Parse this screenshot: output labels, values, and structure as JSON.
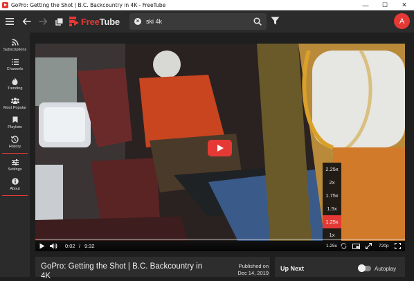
{
  "window": {
    "title": "GoPro: Getting the Shot | B.C. Backcountry in 4K - FreeTube",
    "minimize": "—",
    "maximize": "☐",
    "close": "✕"
  },
  "header": {
    "logo_free": "Free",
    "logo_tube": "Tube",
    "search_value": "ski 4k",
    "avatar_letter": "A"
  },
  "sidebar": {
    "items": [
      {
        "label": "Subscriptions",
        "icon": "rss-icon"
      },
      {
        "label": "Channels",
        "icon": "list-icon"
      },
      {
        "label": "Trending",
        "icon": "fire-icon"
      },
      {
        "label": "Most Popular",
        "icon": "users-icon"
      },
      {
        "label": "Playlists",
        "icon": "bookmark-icon"
      },
      {
        "label": "History",
        "icon": "history-icon"
      }
    ],
    "bottom_items": [
      {
        "label": "Settings",
        "icon": "sliders-icon"
      },
      {
        "label": "About",
        "icon": "info-icon"
      }
    ]
  },
  "player": {
    "current_time": "0:02",
    "separator": "/",
    "duration": "9:32",
    "progress": 0.0035,
    "speed_label": "1.25x",
    "quality_label": "720p",
    "speed_options": [
      "2.25x",
      "2x",
      "1.75x",
      "1.5x",
      "1.25x",
      "1x"
    ],
    "selected_speed": "1.25x"
  },
  "video": {
    "title": "GoPro: Getting the Shot | B.C. Backcountry in 4K",
    "published_label": "Published on",
    "published_date": "Dec 14, 2019"
  },
  "upnext": {
    "title": "Up Next",
    "autoplay_label": "Autoplay",
    "autoplay_on": false
  },
  "colors": {
    "accent": "#e53935",
    "background": "#1f1f1f",
    "panel": "#2d2d2d",
    "header": "#2b2b2b"
  }
}
